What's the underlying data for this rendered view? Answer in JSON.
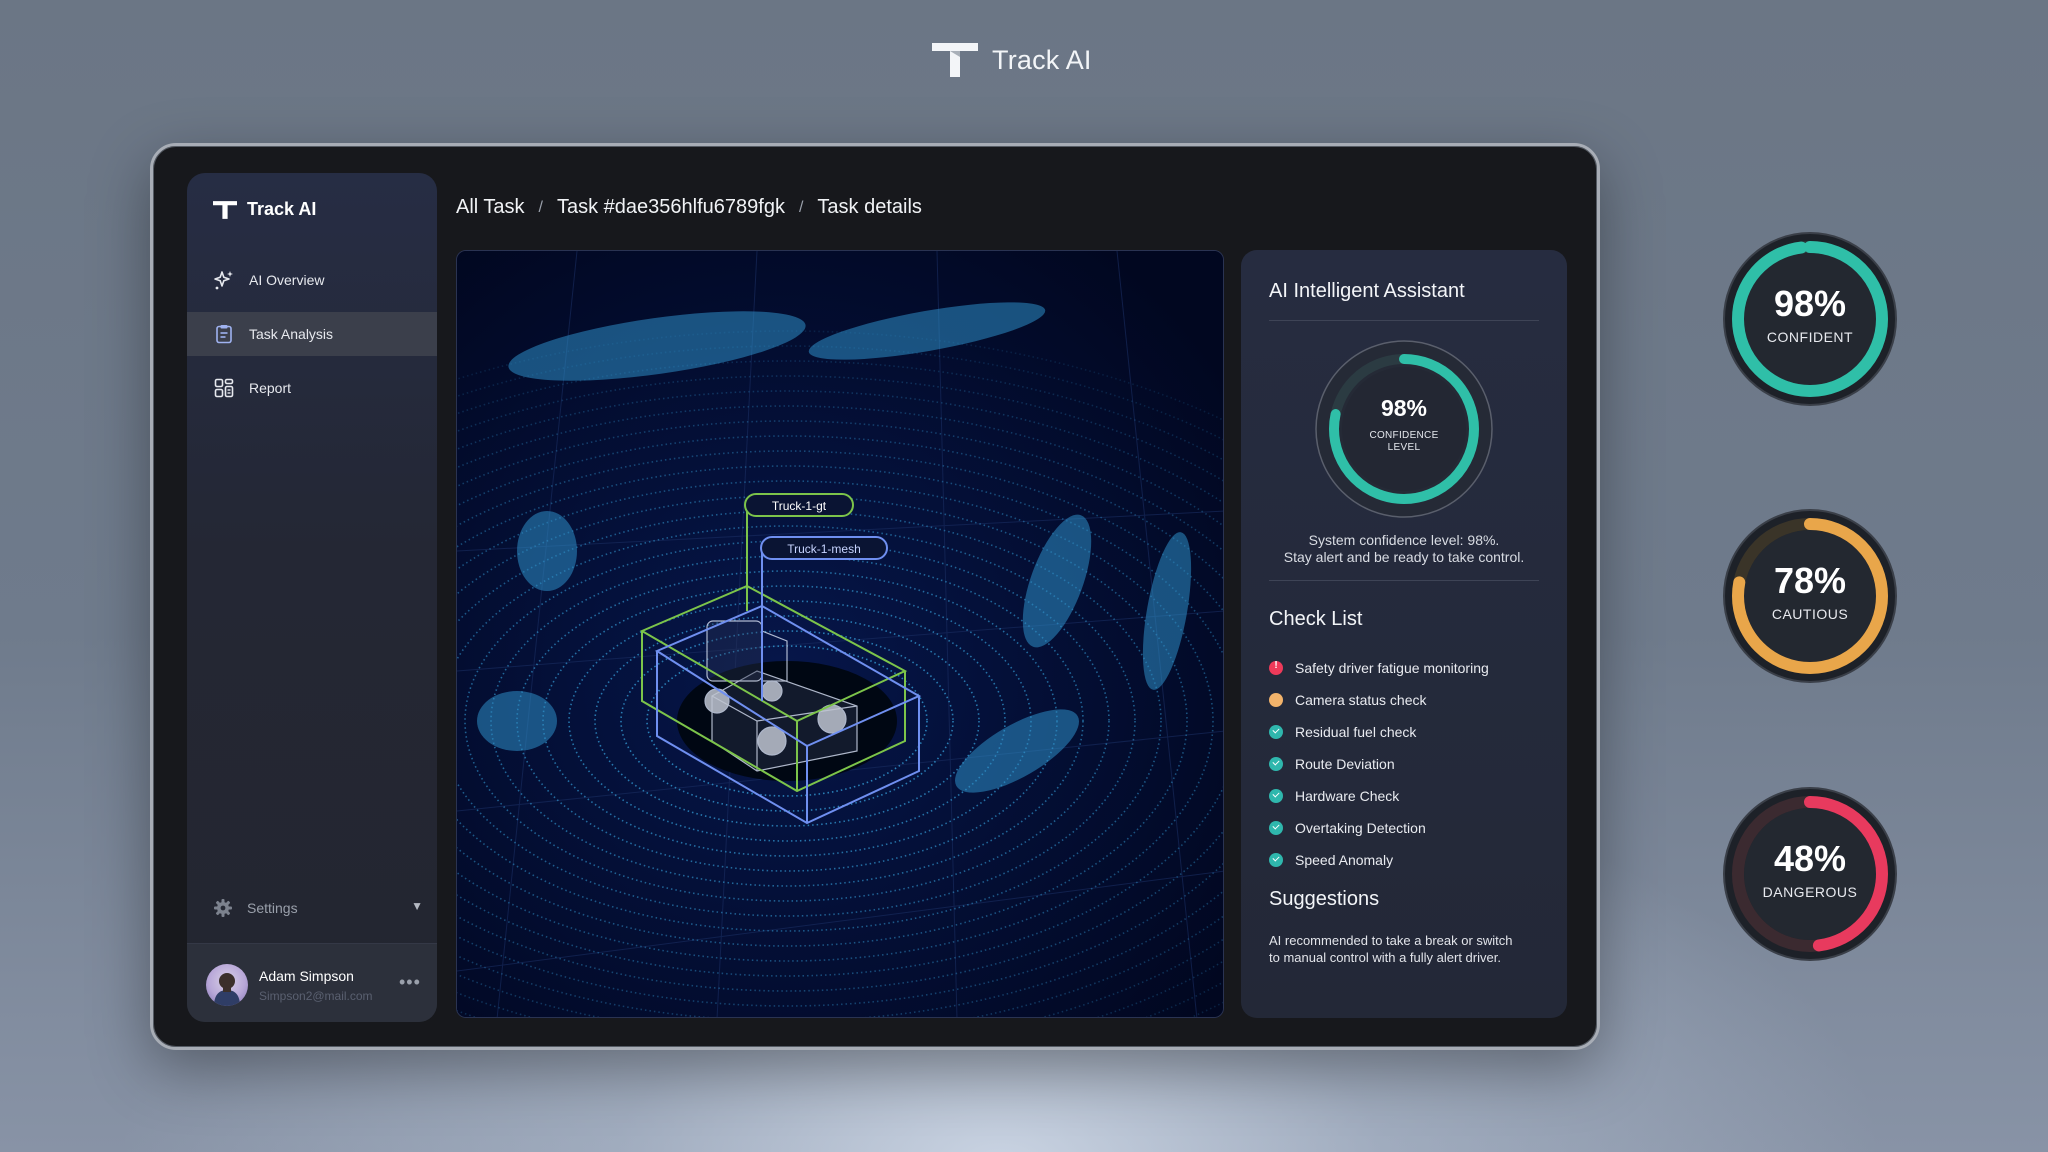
{
  "app": {
    "name": "Track AI"
  },
  "sidebar": {
    "brand": "Track AI",
    "items": [
      {
        "label": "AI Overview",
        "icon": "sparkle-icon",
        "active": false
      },
      {
        "label": "Task Analysis",
        "icon": "clipboard-icon",
        "active": true
      },
      {
        "label": "Report",
        "icon": "report-icon",
        "active": false
      }
    ],
    "settings_label": "Settings",
    "user": {
      "name": "Adam Simpson",
      "email": "Simpson2@mail.com"
    }
  },
  "breadcrumb": {
    "items": [
      "All Task",
      "Task #dae356hlfu6789fgk",
      "Task details"
    ],
    "separator": "/"
  },
  "scene": {
    "labels": {
      "gt": "Truck-1-gt",
      "mesh": "Truck-1-mesh"
    },
    "colors": {
      "gt": "#7cc44a",
      "mesh": "#6f8ff0",
      "points": "#2f8ec6"
    }
  },
  "assistant": {
    "title": "AI Intelligent Assistant",
    "confidence": {
      "value": 98,
      "value_text": "98%",
      "label_line1": "CONFIDENCE",
      "label_line2": "LEVEL"
    },
    "message_line1": "System confidence level: 98%.",
    "message_line2": "Stay alert and be ready to take control.",
    "checklist_title": "Check List",
    "checklist": [
      {
        "label": "Safety driver fatigue monitoring",
        "status": "error"
      },
      {
        "label": "Camera status check",
        "status": "warning"
      },
      {
        "label": "Residual fuel check",
        "status": "ok"
      },
      {
        "label": "Route Deviation",
        "status": "ok"
      },
      {
        "label": "Hardware Check",
        "status": "ok"
      },
      {
        "label": "Overtaking Detection",
        "status": "ok"
      },
      {
        "label": "Speed Anomaly",
        "status": "ok"
      }
    ],
    "suggestions_title": "Suggestions",
    "suggestions_text": "AI recommended to take a break or switch to manual control with a fully alert driver."
  },
  "gauges": [
    {
      "value": 98,
      "value_text": "98%",
      "label": "CONFIDENT",
      "color": "#2fbfa8"
    },
    {
      "value": 78,
      "value_text": "78%",
      "label": "CAUTIOUS",
      "color": "#e9a64a"
    },
    {
      "value": 48,
      "value_text": "48%",
      "label": "DANGEROUS",
      "color": "#e83a5e"
    }
  ],
  "status_colors": {
    "error": "#ee3a5a",
    "warning": "#f2b36b",
    "ok": "#2fb7ad"
  }
}
